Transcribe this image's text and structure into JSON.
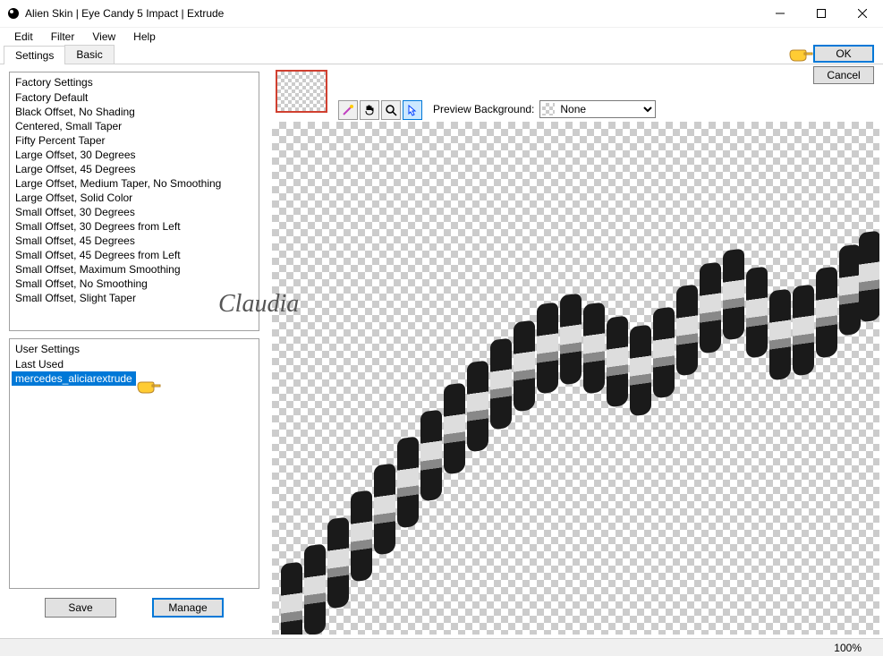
{
  "window": {
    "title": "Alien Skin | Eye Candy 5 Impact | Extrude"
  },
  "menu": {
    "edit": "Edit",
    "filter": "Filter",
    "view": "View",
    "help": "Help"
  },
  "tabs": {
    "settings": "Settings",
    "basic": "Basic"
  },
  "factory": {
    "header": "Factory Settings",
    "items": [
      "Factory Default",
      "Black Offset, No Shading",
      "Centered, Small Taper",
      "Fifty Percent Taper",
      "Large Offset, 30 Degrees",
      "Large Offset, 45 Degrees",
      "Large Offset, Medium Taper, No Smoothing",
      "Large Offset, Solid Color",
      "Small Offset, 30 Degrees",
      "Small Offset, 30 Degrees from Left",
      "Small Offset, 45 Degrees",
      "Small Offset, 45 Degrees from Left",
      "Small Offset, Maximum Smoothing",
      "Small Offset, No Smoothing",
      "Small Offset, Slight Taper"
    ]
  },
  "user": {
    "header": "User Settings",
    "items": [
      "Last Used",
      "mercedes_aliciarextrude"
    ],
    "selected": "mercedes_aliciarextrude"
  },
  "buttons": {
    "save": "Save",
    "manage": "Manage",
    "ok": "OK",
    "cancel": "Cancel"
  },
  "preview": {
    "bg_label": "Preview Background:",
    "bg_value": "None"
  },
  "status": {
    "zoom": "100%"
  },
  "watermark": "Claudia"
}
